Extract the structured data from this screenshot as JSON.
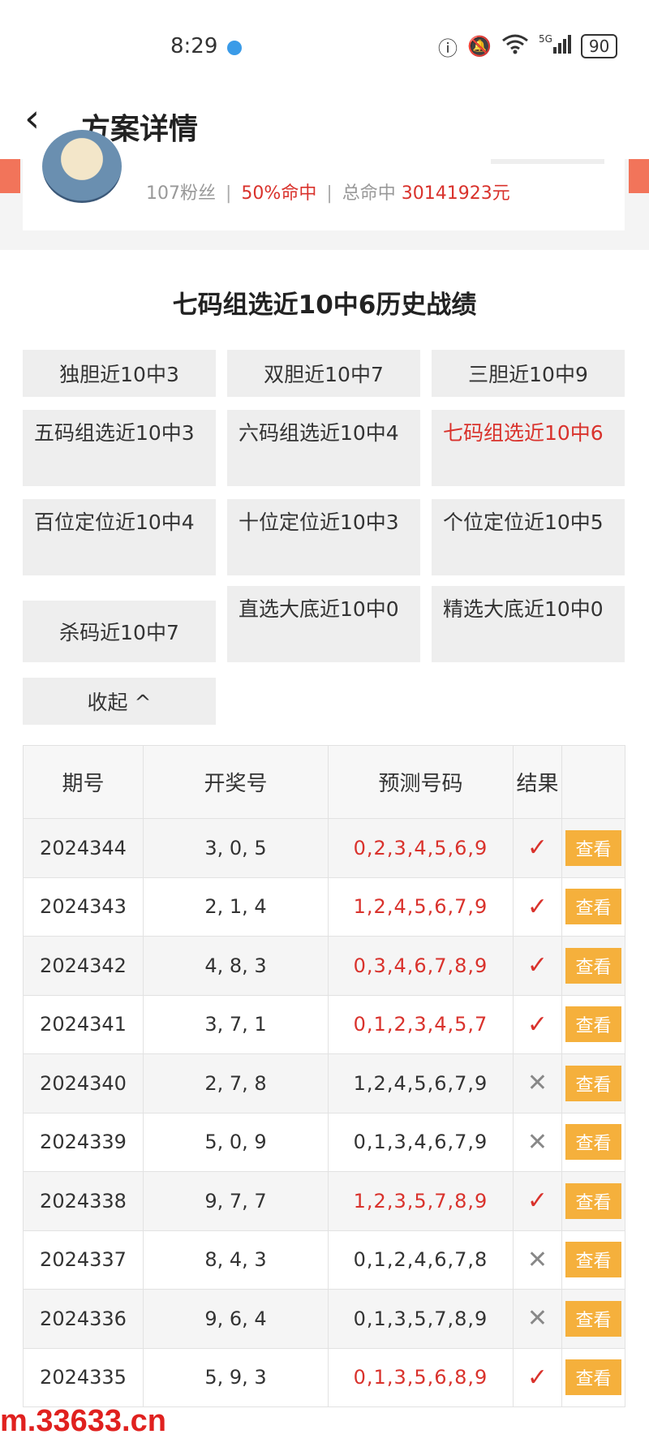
{
  "status_bar": {
    "time": "8:29",
    "battery": "90",
    "network": "5G"
  },
  "header": {
    "title": "方案详情"
  },
  "profile": {
    "fans": "107粉丝",
    "hit_rate": "50%命中",
    "total_label": "总命中",
    "total_value": "30141923元"
  },
  "section_title": "七码组选近10中6历史战绩",
  "tabs": [
    {
      "label": "独胆近10中3"
    },
    {
      "label": "双胆近10中7"
    },
    {
      "label": "三胆近10中9"
    },
    {
      "label": "五码组选近10中3"
    },
    {
      "label": "六码组选近10中4"
    },
    {
      "label": "七码组选近10中6"
    },
    {
      "label": "百位定位近10中4"
    },
    {
      "label": "十位定位近10中3"
    },
    {
      "label": "个位定位近10中5"
    },
    {
      "label": "杀码近10中7"
    },
    {
      "label": "直选大底近10中0"
    },
    {
      "label": "精选大底近10中0"
    },
    {
      "label": "收起 ^"
    }
  ],
  "table": {
    "headers": [
      "期号",
      "开奖号",
      "预测号码",
      "结果",
      ""
    ],
    "view_label": "查看",
    "rows": [
      {
        "issue": "2024344",
        "draw": "3, 0, 5",
        "pred": "0,2,3,4,5,6,9",
        "result": "✓"
      },
      {
        "issue": "2024343",
        "draw": "2, 1, 4",
        "pred": "1,2,4,5,6,7,9",
        "result": "✓"
      },
      {
        "issue": "2024342",
        "draw": "4, 8, 3",
        "pred": "0,3,4,6,7,8,9",
        "result": "✓"
      },
      {
        "issue": "2024341",
        "draw": "3, 7, 1",
        "pred": "0,1,2,3,4,5,7",
        "result": "✓"
      },
      {
        "issue": "2024340",
        "draw": "2, 7, 8",
        "pred": "1,2,4,5,6,7,9",
        "result": "✕"
      },
      {
        "issue": "2024339",
        "draw": "5, 0, 9",
        "pred": "0,1,3,4,6,7,9",
        "result": "✕"
      },
      {
        "issue": "2024338",
        "draw": "9, 7, 7",
        "pred": "1,2,3,5,7,8,9",
        "result": "✓"
      },
      {
        "issue": "2024337",
        "draw": "8, 4, 3",
        "pred": "0,1,2,4,6,7,8",
        "result": "✕"
      },
      {
        "issue": "2024336",
        "draw": "9, 6, 4",
        "pred": "0,1,3,5,7,8,9",
        "result": "✕"
      },
      {
        "issue": "2024335",
        "draw": "5, 9, 3",
        "pred": "0,1,3,5,6,8,9",
        "result": "✓"
      }
    ]
  },
  "watermark": "m.33633.cn",
  "colors": {
    "accent_red": "#d9322c",
    "button_orange": "#f5b03c",
    "banner": "#f2745a"
  }
}
